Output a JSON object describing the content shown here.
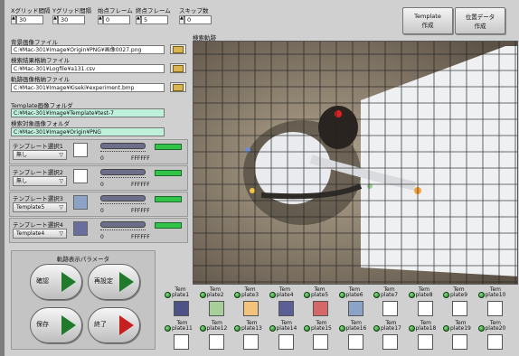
{
  "top_controls": [
    {
      "label": "Xグリッド間隔",
      "value": "30"
    },
    {
      "label": "Yグリッド間隔",
      "value": "30"
    },
    {
      "label": "始点フレーム",
      "value": "0"
    },
    {
      "label": "終点フレーム",
      "value": "5"
    },
    {
      "label": "スキップ数",
      "value": "0"
    }
  ],
  "buttons": {
    "template_create": "Template\n作成",
    "position_data_create": "位置データ\n作成"
  },
  "files": {
    "bg_label": "背景画像ファイル",
    "bg_path": "C:¥Mac-301¥Image¥Origin¥PNG¥画像0027.png",
    "result_label": "検索結果格納ファイル",
    "result_path": "C:¥Mac-301¥Logfile¥a131.csv",
    "track_label": "軌跡画像格納ファイル",
    "track_path": "C:¥Mac-301¥Image¥Kiseki¥experiment.bmp",
    "template_folder_label": "Template画像フォルダ",
    "template_folder_path": "C:¥Mac-301¥Image¥Template¥test-7",
    "search_folder_label": "検索対象画像フォルダ",
    "search_folder_path": "C:¥Mac-301¥Image¥Origin¥PNG"
  },
  "template_selects": [
    {
      "label": "テンプレート選択1",
      "value": "無し",
      "swatch": "#ffffff",
      "min": "0",
      "max": "FFFFFF"
    },
    {
      "label": "テンプレート選択2",
      "value": "無し",
      "swatch": "#ffffff",
      "min": "0",
      "max": "FFFFFF"
    },
    {
      "label": "テンプレート選択3",
      "value": "Template5",
      "swatch": "#8aa3c6",
      "min": "0",
      "max": "FFFFFF"
    },
    {
      "label": "テンプレート選択4",
      "value": "Template4",
      "swatch": "#6a6e9c",
      "min": "0",
      "max": "FFFFFF"
    }
  ],
  "track_params": {
    "title": "軌跡表示パラメータ",
    "confirm": "確認",
    "reset": "再設定",
    "save": "保存",
    "exit": "終了"
  },
  "image_view": {
    "label": "検索軌跡"
  },
  "templates_row1": [
    {
      "name": "Tem\nplate1",
      "color": "#4d5287"
    },
    {
      "name": "Tem\nplate2",
      "color": "#a8cf9a"
    },
    {
      "name": "Tem\nplate3",
      "color": "#f3c37b"
    },
    {
      "name": "Tem\nplate4",
      "color": "#5b5f93"
    },
    {
      "name": "Tem\nplate5",
      "color": "#d46868"
    },
    {
      "name": "Tem\nplate6",
      "color": "#8aa3c6"
    },
    {
      "name": "Tem\nplate7",
      "color": "#ffffff"
    },
    {
      "name": "Tem\nplate8",
      "color": "#ffffff"
    },
    {
      "name": "Tem\nplate9",
      "color": "#ffffff"
    },
    {
      "name": "Tem\nplate10",
      "color": "#ffffff"
    }
  ],
  "templates_row2": [
    {
      "name": "Tem\nplate11",
      "color": "#ffffff"
    },
    {
      "name": "Tem\nplate12",
      "color": "#ffffff"
    },
    {
      "name": "Tem\nplate13",
      "color": "#ffffff"
    },
    {
      "name": "Tem\nplate14",
      "color": "#ffffff"
    },
    {
      "name": "Tem\nplate15",
      "color": "#ffffff"
    },
    {
      "name": "Tem\nplate16",
      "color": "#ffffff"
    },
    {
      "name": "Tem\nplate17",
      "color": "#ffffff"
    },
    {
      "name": "Tem\nplate18",
      "color": "#ffffff"
    },
    {
      "name": "Tem\nplate19",
      "color": "#ffffff"
    },
    {
      "name": "Tem\nplate20",
      "color": "#ffffff"
    }
  ]
}
